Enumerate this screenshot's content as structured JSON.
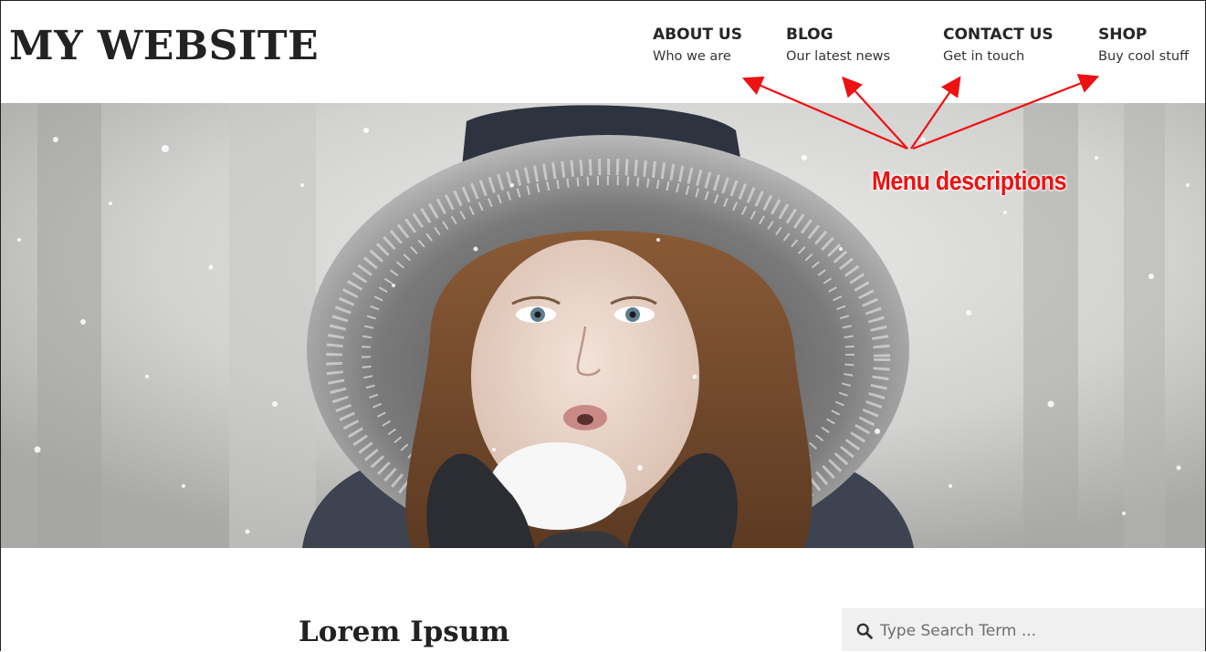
{
  "site": {
    "title": "MY WEBSITE"
  },
  "menu": [
    {
      "label": "ABOUT US",
      "description": "Who we are"
    },
    {
      "label": "BLOG",
      "description": "Our latest news"
    },
    {
      "label": "CONTACT US",
      "description": "Get in touch"
    },
    {
      "label": "SHOP",
      "description": "Buy cool stuff"
    }
  ],
  "annotation": {
    "text": "Menu descriptions",
    "color": "#ee1111"
  },
  "hero": {
    "image": "woman-in-fur-hood-blowing-snow"
  },
  "post": {
    "title": "Lorem Ipsum"
  },
  "search": {
    "placeholder": "Type Search Term ...",
    "icon": "search-icon"
  }
}
